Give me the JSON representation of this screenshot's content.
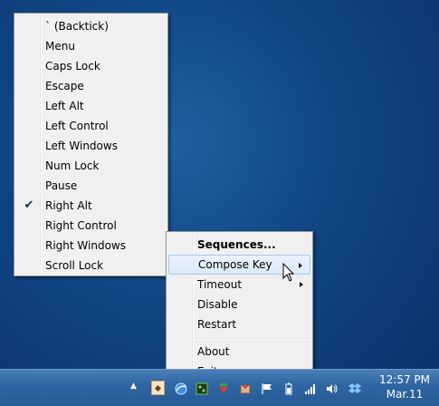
{
  "submenu": {
    "items": [
      {
        "label": "` (Backtick)",
        "checked": false
      },
      {
        "label": "Menu",
        "checked": false
      },
      {
        "label": "Caps Lock",
        "checked": false
      },
      {
        "label": "Escape",
        "checked": false
      },
      {
        "label": "Left Alt",
        "checked": false
      },
      {
        "label": "Left Control",
        "checked": false
      },
      {
        "label": "Left Windows",
        "checked": false
      },
      {
        "label": "Num Lock",
        "checked": false
      },
      {
        "label": "Pause",
        "checked": false
      },
      {
        "label": "Right Alt",
        "checked": true
      },
      {
        "label": "Right Control",
        "checked": false
      },
      {
        "label": "Right Windows",
        "checked": false
      },
      {
        "label": "Scroll Lock",
        "checked": false
      }
    ],
    "check_glyph": "✔"
  },
  "main_menu": {
    "sequences": "Sequences...",
    "compose_key": "Compose Key",
    "timeout": "Timeout",
    "disable": "Disable",
    "restart": "Restart",
    "about": "About",
    "exit": "Exit"
  },
  "taskbar": {
    "show_hidden_icon": "▲",
    "time": "12:57 PM",
    "date": "Mar.11",
    "tray_icons": [
      "wincompose-icon",
      "browser-icon",
      "app-green-icon",
      "download-icon",
      "package-icon",
      "flag-icon",
      "battery-icon",
      "network-icon",
      "volume-icon",
      "dropbox-icon"
    ]
  }
}
